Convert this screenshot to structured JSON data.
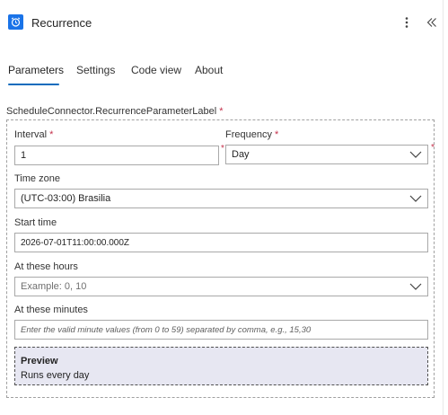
{
  "header": {
    "title": "Recurrence",
    "icon": "alarm-clock-icon",
    "accent": "#1a73e8"
  },
  "tabs": [
    {
      "label": "Parameters",
      "active": true
    },
    {
      "label": "Settings",
      "active": false
    },
    {
      "label": "Code view",
      "active": false
    },
    {
      "label": "About",
      "active": false
    }
  ],
  "section": {
    "label": "ScheduleConnector.RecurrenceParameterLabel",
    "required_mark": "*"
  },
  "fields": {
    "interval": {
      "label": "Interval",
      "required_mark": "*",
      "value": "1"
    },
    "frequency": {
      "label": "Frequency",
      "required_mark": "*",
      "value": "Day"
    },
    "time_zone": {
      "label": "Time zone",
      "value": "(UTC-03:00) Brasilia"
    },
    "start_time": {
      "label": "Start time",
      "value": "2026-07-01T11:00:00.000Z"
    },
    "at_these_hours": {
      "label": "At these hours",
      "placeholder": "Example: 0, 10"
    },
    "at_these_minutes": {
      "label": "At these minutes",
      "placeholder": "Enter the valid minute values (from 0 to 59) separated by comma, e.g., 15,30"
    }
  },
  "preview": {
    "title": "Preview",
    "text": "Runs every day"
  },
  "colors": {
    "tab_underline": "#0f6cbd",
    "required": "#c4314b",
    "preview_bg": "#e7e7f2"
  }
}
